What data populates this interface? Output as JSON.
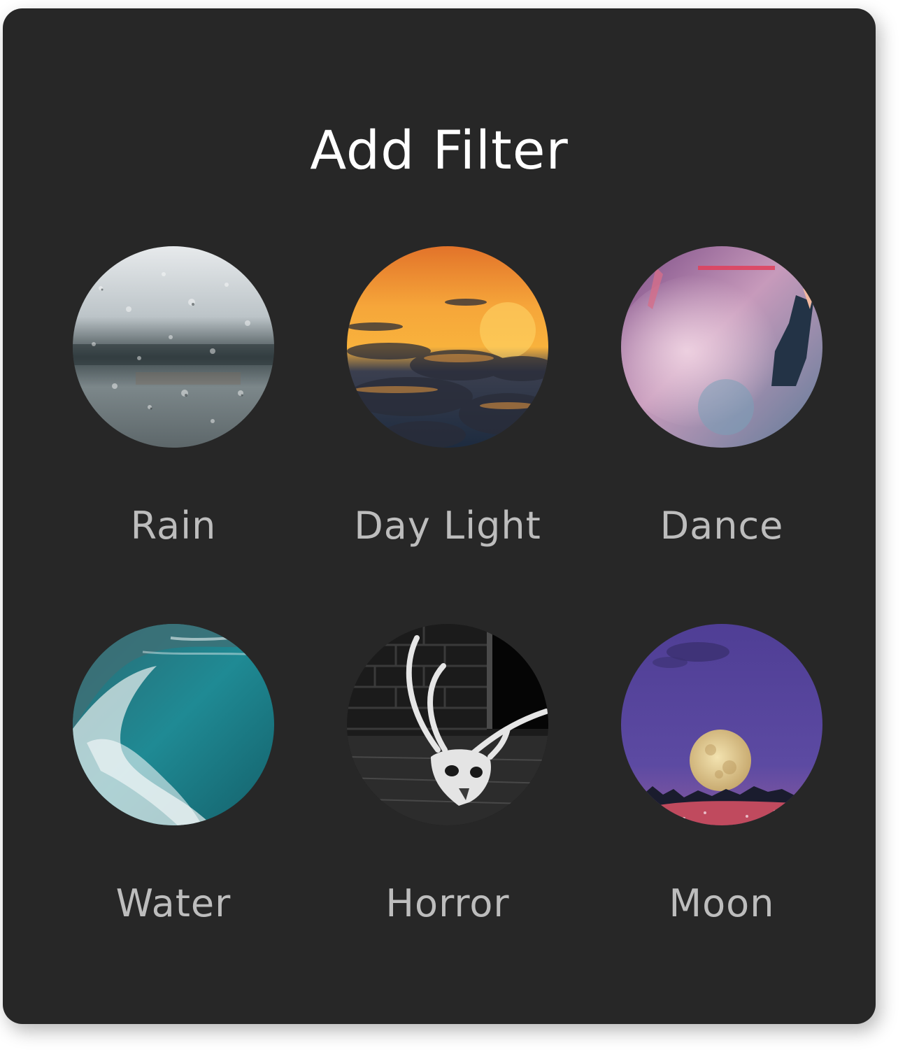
{
  "dialog": {
    "title": "Add Filter"
  },
  "filters": [
    {
      "label": "Rain",
      "icon": "rain-thumbnail"
    },
    {
      "label": "Day Light",
      "icon": "daylight-thumbnail"
    },
    {
      "label": "Dance",
      "icon": "dance-thumbnail"
    },
    {
      "label": "Water",
      "icon": "water-thumbnail"
    },
    {
      "label": "Horror",
      "icon": "horror-thumbnail"
    },
    {
      "label": "Moon",
      "icon": "moon-thumbnail"
    }
  ],
  "colors": {
    "panel_background": "#272727",
    "title_text": "#ffffff",
    "label_text": "#bdbdbd"
  }
}
